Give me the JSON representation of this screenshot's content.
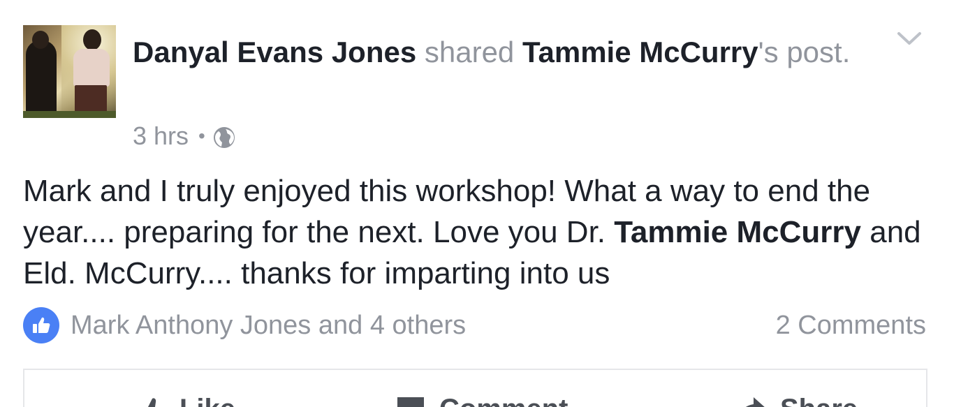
{
  "post": {
    "author": "Danyal Evans Jones",
    "action_text": "shared",
    "original_author": "Tammie McCurry",
    "post_suffix": "'s post.",
    "time": "3 hrs",
    "separator": "•",
    "visibility_icon": "globe-icon",
    "body_part1": "Mark and I truly enjoyed this workshop! What a way to end the year.... preparing for the next. Love you Dr. ",
    "body_mention": "Tammie McCurry",
    "body_part2": " and Eld. McCurry.... thanks for imparting into us"
  },
  "reactions": {
    "icon": "like-icon",
    "summary": "Mark Anthony Jones and 4 others",
    "comments": "2 Comments"
  },
  "actions": {
    "like_label": "Like",
    "comment_label": "Comment",
    "share_label": "Share"
  },
  "colors": {
    "text_primary": "#1d2129",
    "text_secondary": "#90949c",
    "like_blue": "#4a80f5",
    "divider": "#e5e6e9"
  }
}
